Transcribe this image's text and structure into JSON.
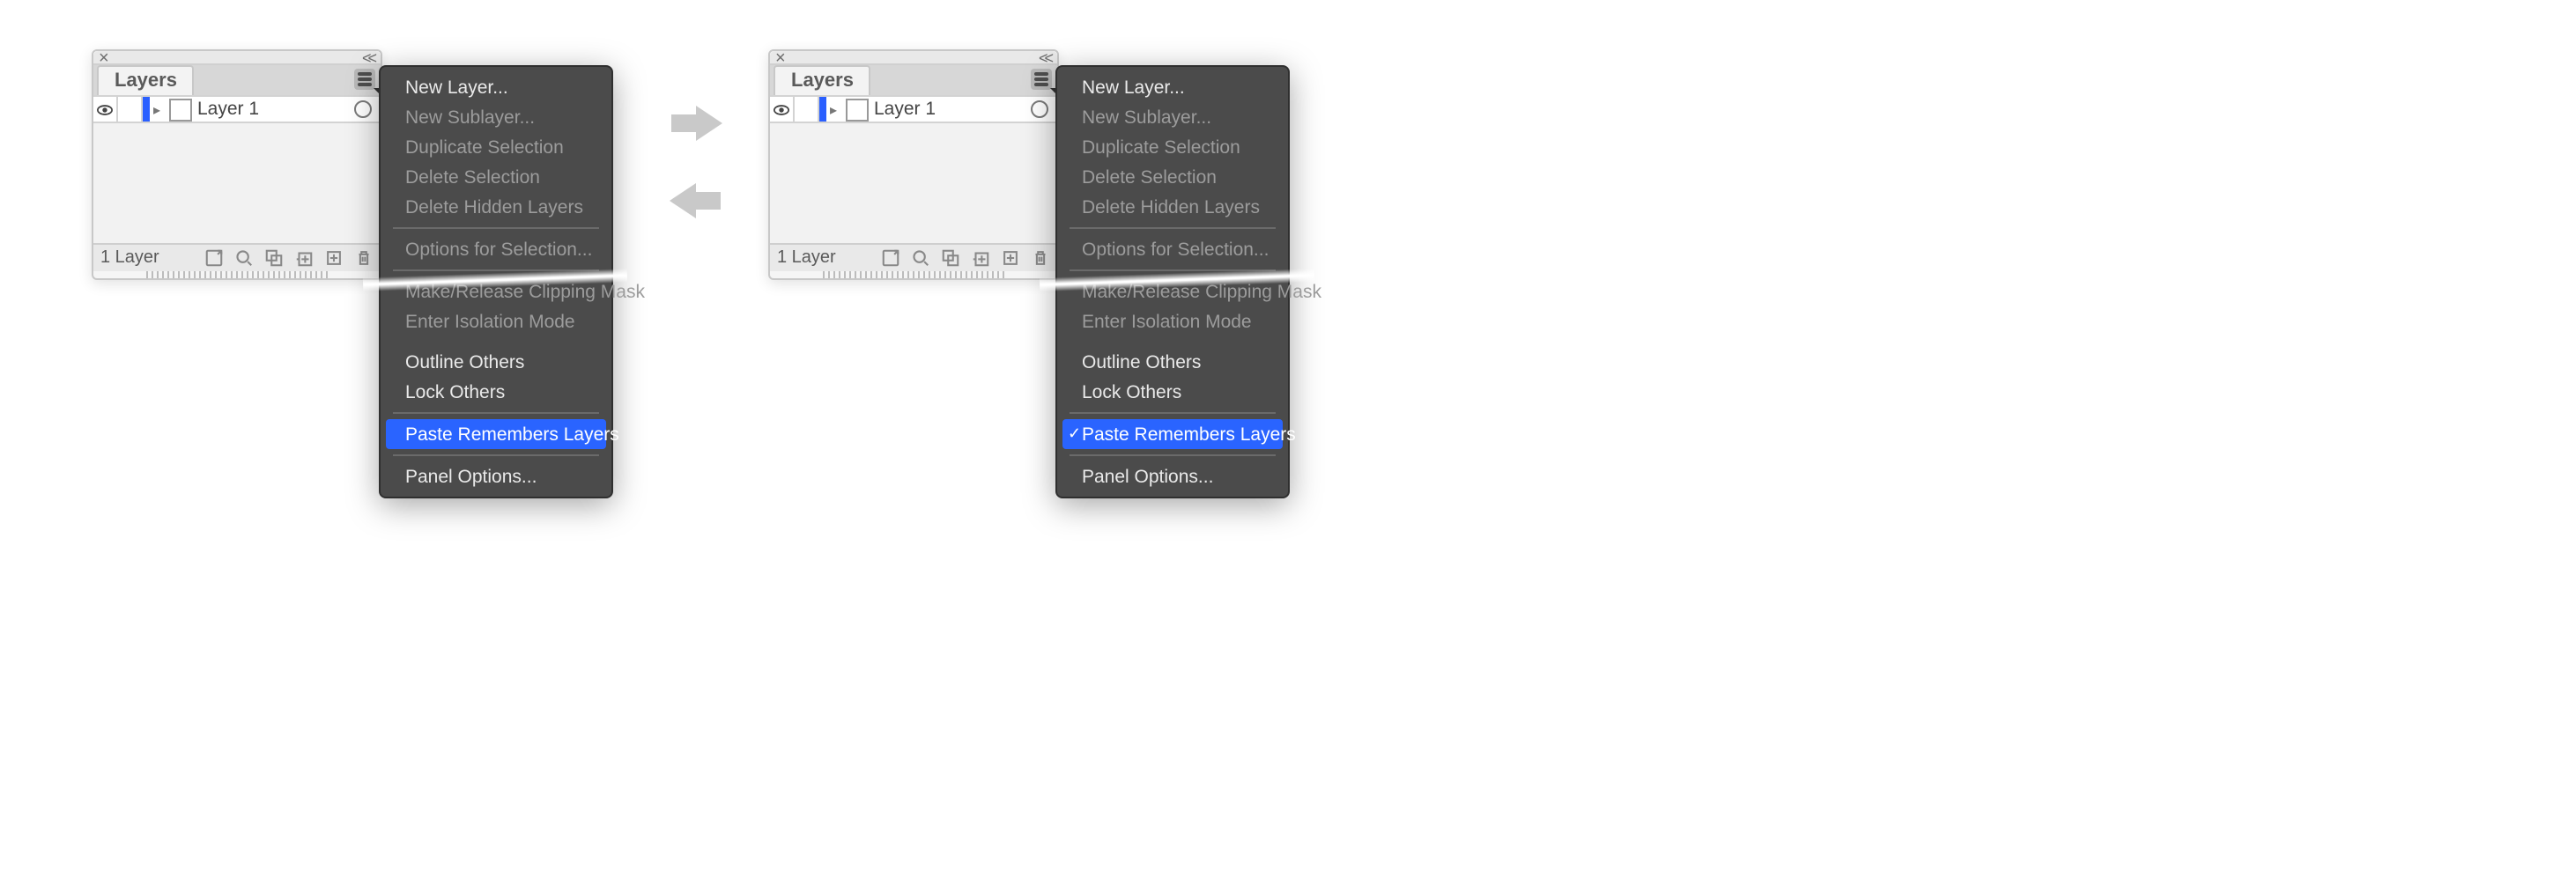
{
  "panel": {
    "tab": "Layers",
    "layerName": "Layer 1",
    "footerLabel": "1 Layer"
  },
  "menu": {
    "newLayer": "New Layer...",
    "newSublayer": "New Sublayer...",
    "dupSel": "Duplicate Selection",
    "delSel": "Delete Selection",
    "delHidden": "Delete Hidden Layers",
    "optSel": "Options for Selection...",
    "clipMask": "Make/Release Clipping Mask",
    "enterIso": "Enter Isolation Mode",
    "outlineOthers": "Outline Others",
    "lockOthers": "Lock Others",
    "pasteRemembers": "Paste Remembers Layers",
    "panelOptions": "Panel Options..."
  }
}
